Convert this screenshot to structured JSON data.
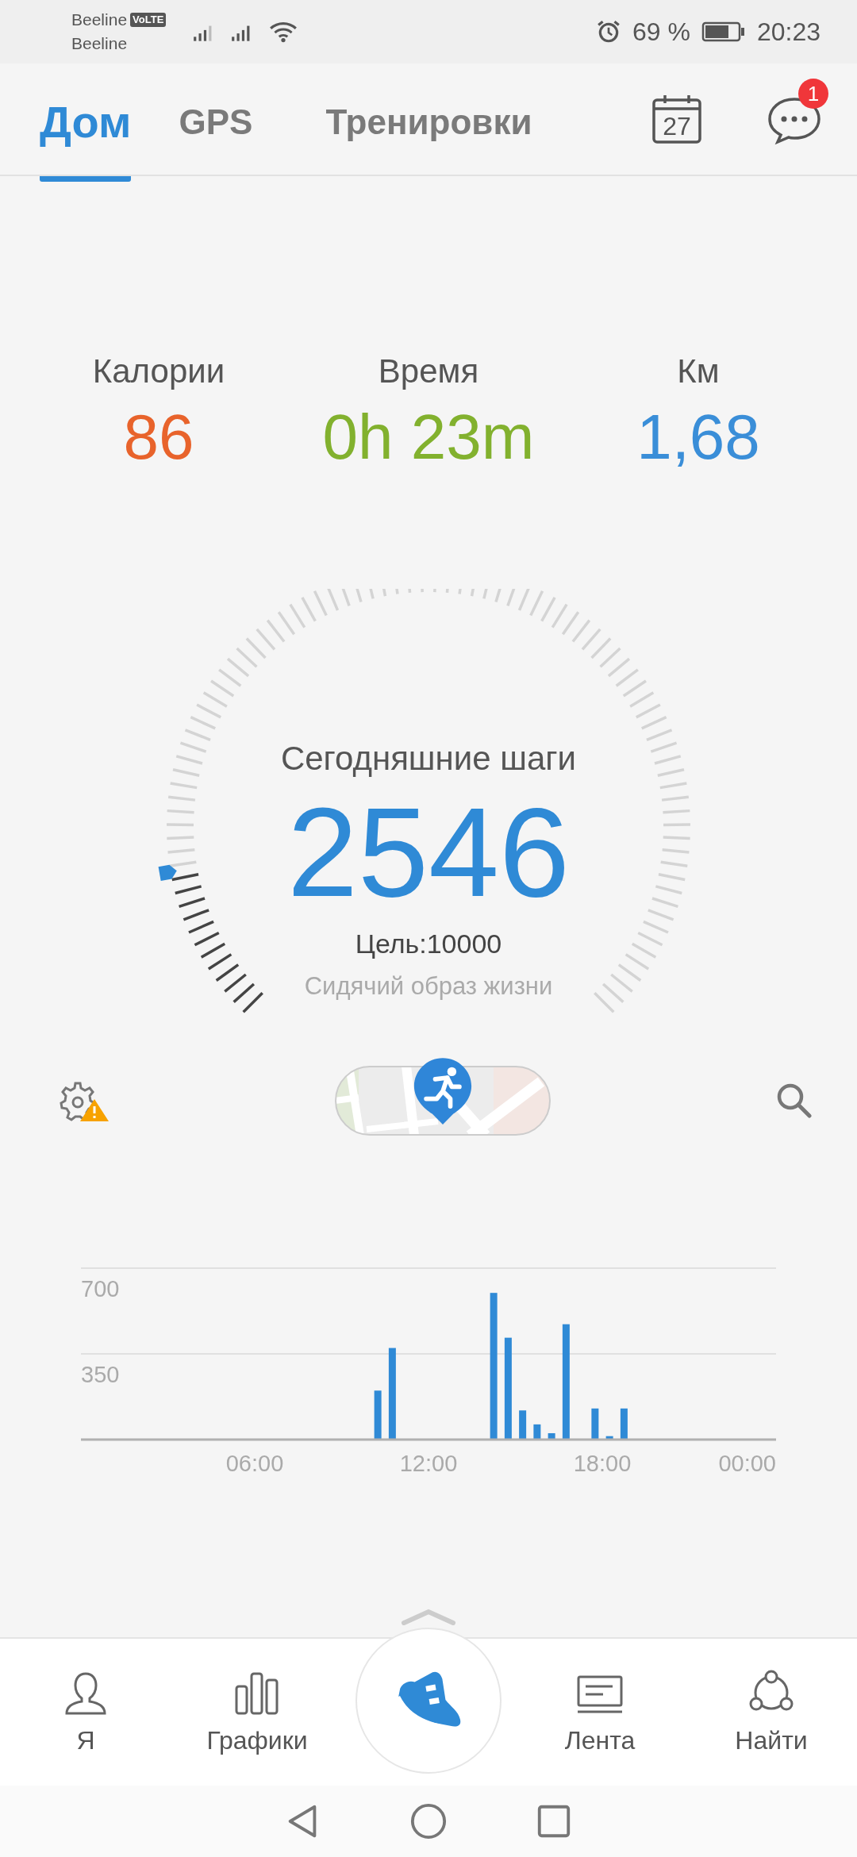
{
  "status_bar": {
    "carrier_1": "Beeline",
    "network_badge": "VoLTE",
    "carrier_2": "Beeline",
    "battery": "69 %",
    "time": "20:23"
  },
  "tabs": [
    {
      "label": "Дом",
      "selected": true
    },
    {
      "label": "GPS",
      "selected": false
    },
    {
      "label": "Тренировки",
      "selected": false
    }
  ],
  "header": {
    "calendar_day": "27",
    "messages_badge": "1"
  },
  "stats": [
    {
      "label": "Калории",
      "value": "86",
      "color": "#e8632b"
    },
    {
      "label": "Время",
      "value": "0h 23m",
      "color": "#82b12e"
    },
    {
      "label": "Км",
      "value": "1,68",
      "color": "#3a8ed8"
    }
  ],
  "steps": {
    "title": "Сегодняшние шаги",
    "count": "2546",
    "goal": "Цель:10000",
    "activity": "Сидячий образ жизни"
  },
  "chart_data": {
    "type": "bar",
    "x": [
      10.25,
      10.75,
      14.25,
      14.75,
      15.25,
      15.75,
      16.25,
      16.75,
      17.75,
      18.25,
      18.75
    ],
    "values": [
      200,
      374,
      599,
      416,
      119,
      62,
      26,
      471,
      127,
      14,
      127
    ],
    "xlim": [
      0,
      24
    ],
    "ylim": [
      0,
      700
    ],
    "xticks": [
      {
        "value": 6,
        "label": "06:00"
      },
      {
        "value": 12,
        "label": "12:00"
      },
      {
        "value": 18,
        "label": "18:00"
      },
      {
        "value": 24,
        "label": "00:00"
      }
    ],
    "yticks": [
      350,
      700
    ]
  },
  "bottom_nav": [
    {
      "label": "Я",
      "kind": "person"
    },
    {
      "label": "Графики",
      "kind": "bars"
    },
    {
      "kind": "center"
    },
    {
      "label": "Лента",
      "kind": "feed"
    },
    {
      "label": "Найти",
      "kind": "network"
    }
  ]
}
